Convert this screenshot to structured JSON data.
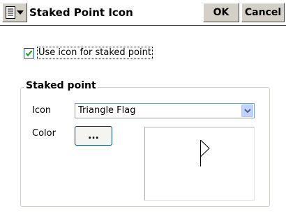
{
  "window": {
    "title": "Staked Point Icon",
    "ok_label": "OK",
    "cancel_label": "Cancel"
  },
  "checkbox": {
    "label": "Use icon for staked point",
    "checked": true
  },
  "group": {
    "title": "Staked point",
    "icon_label": "Icon",
    "icon_value": "Triangle Flag",
    "color_label": "Color",
    "color_button_label": "..."
  },
  "colors": {
    "check": "#21a121",
    "select_arrow_bg": "#c1d3fb",
    "button_face": "#d4d0c8"
  }
}
